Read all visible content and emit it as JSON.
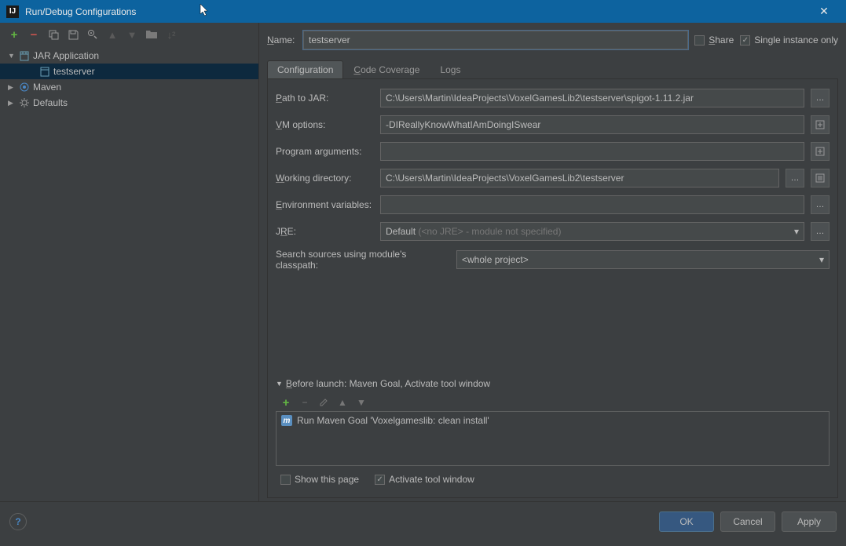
{
  "window": {
    "title": "Run/Debug Configurations"
  },
  "tree": {
    "jar_app": "JAR Application",
    "testserver": "testserver",
    "maven": "Maven",
    "defaults": "Defaults"
  },
  "nameRow": {
    "label": "Name:",
    "value": "testserver",
    "share": "Share",
    "single": "Single instance only"
  },
  "tabs": {
    "configuration": "Configuration",
    "coverage": "Code Coverage",
    "logs": "Logs"
  },
  "form": {
    "path_label": "Path to JAR:",
    "path_value": "C:\\Users\\Martin\\IdeaProjects\\VoxelGamesLib2\\testserver\\spigot-1.11.2.jar",
    "vm_label": "VM options:",
    "vm_value": "-DIReallyKnowWhatIAmDoingISwear",
    "args_label": "Program arguments:",
    "args_value": "",
    "wd_label": "Working directory:",
    "wd_value": "C:\\Users\\Martin\\IdeaProjects\\VoxelGamesLib2\\testserver",
    "env_label": "Environment variables:",
    "env_value": "",
    "jre_label": "JRE:",
    "jre_value": "Default",
    "jre_placeholder": " (<no JRE>  - module not specified)",
    "search_label": "Search sources using module's classpath:",
    "search_value": "<whole project>"
  },
  "beforeLaunch": {
    "header": "Before launch: Maven Goal, Activate tool window",
    "item": "Run Maven Goal 'Voxelgameslib: clean install'",
    "show_page": "Show this page",
    "activate": "Activate tool window"
  },
  "footer": {
    "ok": "OK",
    "cancel": "Cancel",
    "apply": "Apply"
  }
}
